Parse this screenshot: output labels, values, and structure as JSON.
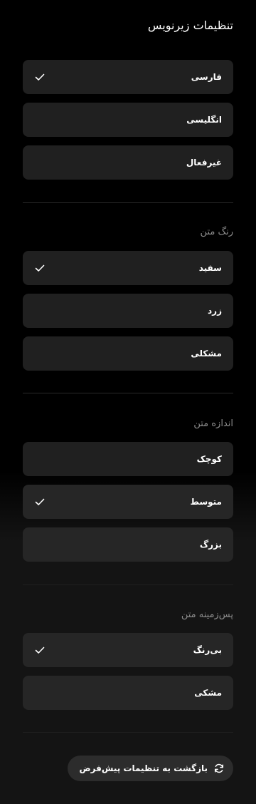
{
  "header": {
    "title": "تنظیمات زیرنویس"
  },
  "language": {
    "options": [
      {
        "label": "فارسی",
        "selected": true
      },
      {
        "label": "انگلیسی",
        "selected": false
      },
      {
        "label": "غیرفعال",
        "selected": false
      }
    ]
  },
  "text_color": {
    "label": "رنگ متن",
    "options": [
      {
        "label": "سفید",
        "selected": true
      },
      {
        "label": "زرد",
        "selected": false
      },
      {
        "label": "مشکلی",
        "selected": false
      }
    ]
  },
  "text_size": {
    "label": "اندازه متن",
    "options": [
      {
        "label": "کوچک",
        "selected": false
      },
      {
        "label": "متوسط",
        "selected": true
      },
      {
        "label": "بزرگ",
        "selected": false
      }
    ]
  },
  "text_background": {
    "label": "پس‌زمینه متن",
    "options": [
      {
        "label": "بی‌رنگ",
        "selected": true
      },
      {
        "label": "مشکی",
        "selected": false
      }
    ]
  },
  "reset": {
    "label": "بازگشت به تنظیمات پیش‌فرض",
    "icon": "refresh-icon"
  },
  "icons": {
    "check": "check-icon"
  },
  "colors": {
    "background": "#000000",
    "option_background": "#202020",
    "section_label": "#8c8c8c",
    "text": "#ffffff"
  }
}
